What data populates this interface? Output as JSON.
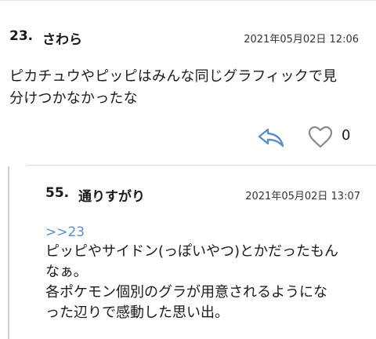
{
  "comments": [
    {
      "number": "23.",
      "name": "さわら",
      "date": "2021年05月02日 12:06",
      "body_lines": [
        "ピカチュウやピッピはみんな同じグラフィックで見",
        "分けつかなかったな"
      ],
      "like_count": "0",
      "icons": {
        "reply": "reply-arrow-icon",
        "like": "heart-outline-icon"
      }
    },
    {
      "number": "55.",
      "name": "通りすがり",
      "date": "2021年05月02日 13:07",
      "anchor": ">>23",
      "body_lines": [
        "ピッピやサイドン(っぽいやつ)とかだったもん",
        "なぁ。",
        "各ポケモン個別のグラが用意されるようにな",
        "った辺りで感動した思い出。"
      ]
    }
  ],
  "colors": {
    "accent": "#5b8fc7",
    "icon_gray": "#8a8a8a",
    "rule": "#dcdcdc"
  }
}
